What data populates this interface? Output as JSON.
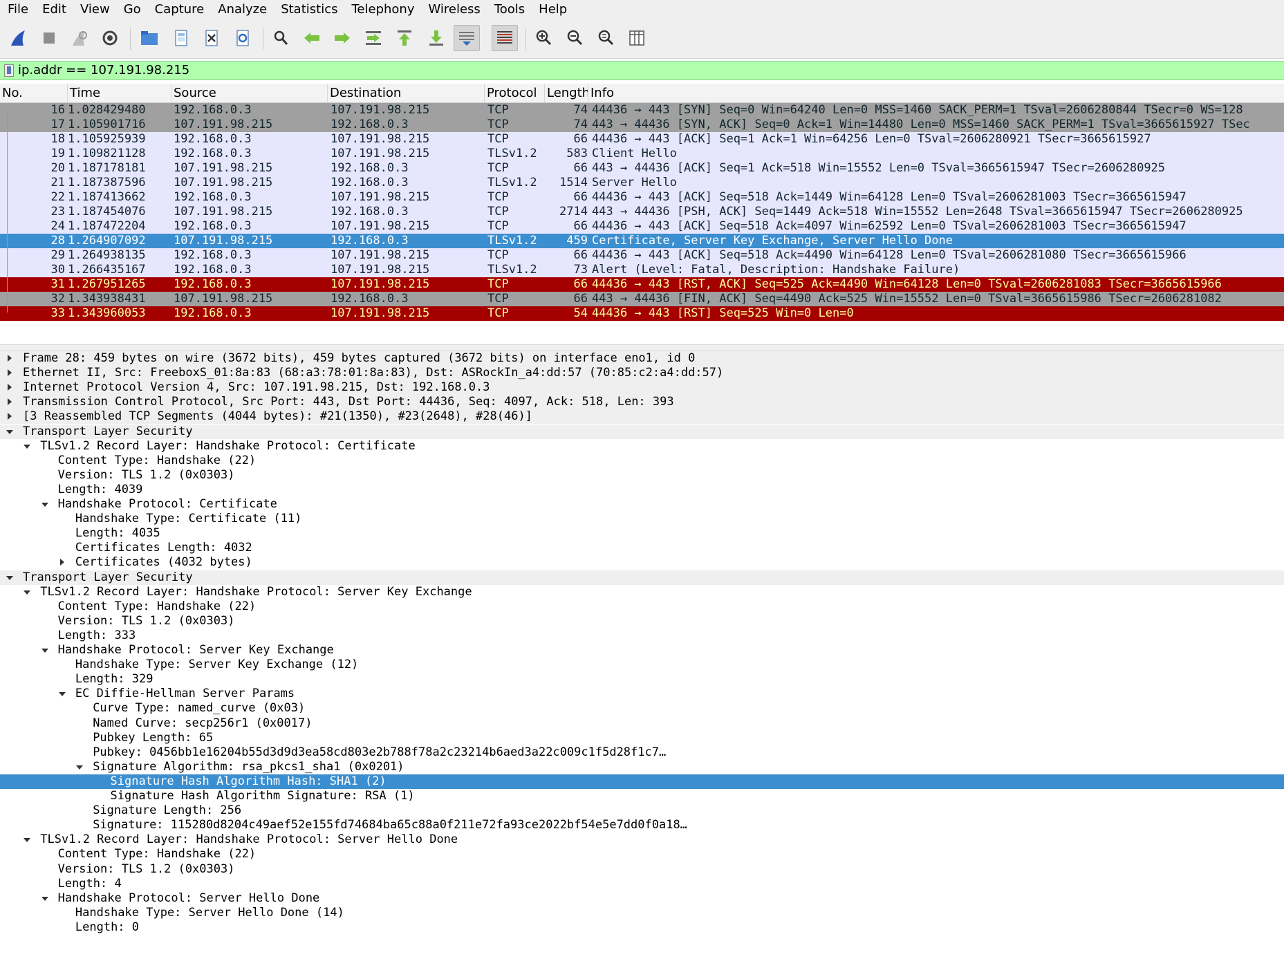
{
  "menu": [
    "File",
    "Edit",
    "View",
    "Go",
    "Capture",
    "Analyze",
    "Statistics",
    "Telephony",
    "Wireless",
    "Tools",
    "Help"
  ],
  "toolbar": {
    "icons": [
      "shark-fin-start-icon",
      "stop-capture-icon",
      "restart-capture-icon",
      "capture-options-icon",
      "open-file-icon",
      "save-file-icon",
      "close-file-icon",
      "reload-file-icon",
      "find-packet-icon",
      "go-back-icon",
      "go-forward-icon",
      "go-to-packet-icon",
      "go-first-packet-icon",
      "go-last-packet-icon",
      "auto-scroll-icon",
      "colorize-icon",
      "zoom-in-icon",
      "zoom-out-icon",
      "zoom-normal-icon",
      "resize-columns-icon"
    ]
  },
  "filter": {
    "value": "ip.addr == 107.191.98.215"
  },
  "packet_list": {
    "columns": [
      "No.",
      "Time",
      "Source",
      "Destination",
      "Protocol",
      "Length",
      "Info"
    ],
    "rows": [
      {
        "no": "16",
        "time": "1.028429480",
        "src": "192.168.0.3",
        "dst": "107.191.98.215",
        "proto": "TCP",
        "len": "74",
        "info": "44436 → 443 [SYN] Seq=0 Win=64240 Len=0 MSS=1460 SACK_PERM=1 TSval=2606280844 TSecr=0 WS=128",
        "style": "gray"
      },
      {
        "no": "17",
        "time": "1.105901716",
        "src": "107.191.98.215",
        "dst": "192.168.0.3",
        "proto": "TCP",
        "len": "74",
        "info": "443 → 44436 [SYN, ACK] Seq=0 Ack=1 Win=14480 Len=0 MSS=1460 SACK_PERM=1 TSval=3665615927 TSec",
        "style": "gray"
      },
      {
        "no": "18",
        "time": "1.105925939",
        "src": "192.168.0.3",
        "dst": "107.191.98.215",
        "proto": "TCP",
        "len": "66",
        "info": "44436 → 443 [ACK] Seq=1 Ack=1 Win=64256 Len=0 TSval=2606280921 TSecr=3665615927",
        "style": "lav"
      },
      {
        "no": "19",
        "time": "1.109821128",
        "src": "192.168.0.3",
        "dst": "107.191.98.215",
        "proto": "TLSv1.2",
        "len": "583",
        "info": "Client Hello",
        "style": "lav"
      },
      {
        "no": "20",
        "time": "1.187178181",
        "src": "107.191.98.215",
        "dst": "192.168.0.3",
        "proto": "TCP",
        "len": "66",
        "info": "443 → 44436 [ACK] Seq=1 Ack=518 Win=15552 Len=0 TSval=3665615947 TSecr=2606280925",
        "style": "lav"
      },
      {
        "no": "21",
        "time": "1.187387596",
        "src": "107.191.98.215",
        "dst": "192.168.0.3",
        "proto": "TLSv1.2",
        "len": "1514",
        "info": "Server Hello",
        "style": "lav"
      },
      {
        "no": "22",
        "time": "1.187413662",
        "src": "192.168.0.3",
        "dst": "107.191.98.215",
        "proto": "TCP",
        "len": "66",
        "info": "44436 → 443 [ACK] Seq=518 Ack=1449 Win=64128 Len=0 TSval=2606281003 TSecr=3665615947",
        "style": "lav"
      },
      {
        "no": "23",
        "time": "1.187454076",
        "src": "107.191.98.215",
        "dst": "192.168.0.3",
        "proto": "TCP",
        "len": "2714",
        "info": "443 → 44436 [PSH, ACK] Seq=1449 Ack=518 Win=15552 Len=2648 TSval=3665615947 TSecr=2606280925",
        "style": "lav"
      },
      {
        "no": "24",
        "time": "1.187472204",
        "src": "192.168.0.3",
        "dst": "107.191.98.215",
        "proto": "TCP",
        "len": "66",
        "info": "44436 → 443 [ACK] Seq=518 Ack=4097 Win=62592 Len=0 TSval=2606281003 TSecr=3665615947",
        "style": "lav"
      },
      {
        "no": "28",
        "time": "1.264907092",
        "src": "107.191.98.215",
        "dst": "192.168.0.3",
        "proto": "TLSv1.2",
        "len": "459",
        "info": "Certificate, Server Key Exchange, Server Hello Done",
        "style": "sel"
      },
      {
        "no": "29",
        "time": "1.264938135",
        "src": "192.168.0.3",
        "dst": "107.191.98.215",
        "proto": "TCP",
        "len": "66",
        "info": "44436 → 443 [ACK] Seq=518 Ack=4490 Win=64128 Len=0 TSval=2606281080 TSecr=3665615966",
        "style": "lav"
      },
      {
        "no": "30",
        "time": "1.266435167",
        "src": "192.168.0.3",
        "dst": "107.191.98.215",
        "proto": "TLSv1.2",
        "len": "73",
        "info": "Alert (Level: Fatal, Description: Handshake Failure)",
        "style": "lav"
      },
      {
        "no": "31",
        "time": "1.267951265",
        "src": "192.168.0.3",
        "dst": "107.191.98.215",
        "proto": "TCP",
        "len": "66",
        "info": "44436 → 443 [RST, ACK] Seq=525 Ack=4490 Win=64128 Len=0 TSval=2606281083 TSecr=3665615966",
        "style": "red"
      },
      {
        "no": "32",
        "time": "1.343938431",
        "src": "107.191.98.215",
        "dst": "192.168.0.3",
        "proto": "TCP",
        "len": "66",
        "info": "443 → 44436 [FIN, ACK] Seq=4490 Ack=525 Win=15552 Len=0 TSval=3665615986 TSecr=2606281082",
        "style": "gray"
      },
      {
        "no": "33",
        "time": "1.343960053",
        "src": "192.168.0.3",
        "dst": "107.191.98.215",
        "proto": "TCP",
        "len": "54",
        "info": "44436 → 443 [RST] Seq=525 Win=0 Len=0",
        "style": "red"
      }
    ]
  },
  "details": [
    {
      "text": "Frame 28: 459 bytes on wire (3672 bits), 459 bytes captured (3672 bits) on interface eno1, id 0",
      "level": 0,
      "arrow": "right",
      "hdr": true
    },
    {
      "text": "Ethernet II, Src: FreeboxS_01:8a:83 (68:a3:78:01:8a:83), Dst: ASRockIn_a4:dd:57 (70:85:c2:a4:dd:57)",
      "level": 0,
      "arrow": "right",
      "hdr": true
    },
    {
      "text": "Internet Protocol Version 4, Src: 107.191.98.215, Dst: 192.168.0.3",
      "level": 0,
      "arrow": "right",
      "hdr": true
    },
    {
      "text": "Transmission Control Protocol, Src Port: 443, Dst Port: 44436, Seq: 4097, Ack: 518, Len: 393",
      "level": 0,
      "arrow": "right",
      "hdr": true
    },
    {
      "text": "[3 Reassembled TCP Segments (4044 bytes): #21(1350), #23(2648), #28(46)]",
      "level": 0,
      "arrow": "right",
      "hdr": true
    },
    {
      "text": "Transport Layer Security",
      "level": 0,
      "arrow": "down",
      "hdr": true
    },
    {
      "text": "TLSv1.2 Record Layer: Handshake Protocol: Certificate",
      "level": 1,
      "arrow": "down"
    },
    {
      "text": "Content Type: Handshake (22)",
      "level": 2,
      "arrow": ""
    },
    {
      "text": "Version: TLS 1.2 (0x0303)",
      "level": 2,
      "arrow": ""
    },
    {
      "text": "Length: 4039",
      "level": 2,
      "arrow": ""
    },
    {
      "text": "Handshake Protocol: Certificate",
      "level": 2,
      "arrow": "down"
    },
    {
      "text": "Handshake Type: Certificate (11)",
      "level": 3,
      "arrow": ""
    },
    {
      "text": "Length: 4035",
      "level": 3,
      "arrow": ""
    },
    {
      "text": "Certificates Length: 4032",
      "level": 3,
      "arrow": ""
    },
    {
      "text": "Certificates (4032 bytes)",
      "level": 3,
      "arrow": "right"
    },
    {
      "text": "Transport Layer Security",
      "level": 0,
      "arrow": "down",
      "hdr": true
    },
    {
      "text": "TLSv1.2 Record Layer: Handshake Protocol: Server Key Exchange",
      "level": 1,
      "arrow": "down"
    },
    {
      "text": "Content Type: Handshake (22)",
      "level": 2,
      "arrow": ""
    },
    {
      "text": "Version: TLS 1.2 (0x0303)",
      "level": 2,
      "arrow": ""
    },
    {
      "text": "Length: 333",
      "level": 2,
      "arrow": ""
    },
    {
      "text": "Handshake Protocol: Server Key Exchange",
      "level": 2,
      "arrow": "down"
    },
    {
      "text": "Handshake Type: Server Key Exchange (12)",
      "level": 3,
      "arrow": ""
    },
    {
      "text": "Length: 329",
      "level": 3,
      "arrow": ""
    },
    {
      "text": "EC Diffie-Hellman Server Params",
      "level": 3,
      "arrow": "down"
    },
    {
      "text": "Curve Type: named_curve (0x03)",
      "level": 4,
      "arrow": ""
    },
    {
      "text": "Named Curve: secp256r1 (0x0017)",
      "level": 4,
      "arrow": ""
    },
    {
      "text": "Pubkey Length: 65",
      "level": 4,
      "arrow": ""
    },
    {
      "text": "Pubkey: 0456bb1e16204b55d3d9d3ea58cd803e2b788f78a2c23214b6aed3a22c009c1f5d28f1c7…",
      "level": 4,
      "arrow": ""
    },
    {
      "text": "Signature Algorithm: rsa_pkcs1_sha1 (0x0201)",
      "level": 4,
      "arrow": "down"
    },
    {
      "text": "Signature Hash Algorithm Hash: SHA1 (2)",
      "level": 5,
      "arrow": "",
      "sel": true
    },
    {
      "text": "Signature Hash Algorithm Signature: RSA (1)",
      "level": 5,
      "arrow": ""
    },
    {
      "text": "Signature Length: 256",
      "level": 4,
      "arrow": ""
    },
    {
      "text": "Signature: 115280d8204c49aef52e155fd74684ba65c88a0f211e72fa93ce2022bf54e5e7dd0f0a18…",
      "level": 4,
      "arrow": ""
    },
    {
      "text": "TLSv1.2 Record Layer: Handshake Protocol: Server Hello Done",
      "level": 1,
      "arrow": "down"
    },
    {
      "text": "Content Type: Handshake (22)",
      "level": 2,
      "arrow": ""
    },
    {
      "text": "Version: TLS 1.2 (0x0303)",
      "level": 2,
      "arrow": ""
    },
    {
      "text": "Length: 4",
      "level": 2,
      "arrow": ""
    },
    {
      "text": "Handshake Protocol: Server Hello Done",
      "level": 2,
      "arrow": "down"
    },
    {
      "text": "Handshake Type: Server Hello Done (14)",
      "level": 3,
      "arrow": ""
    },
    {
      "text": "Length: 0",
      "level": 3,
      "arrow": ""
    }
  ]
}
